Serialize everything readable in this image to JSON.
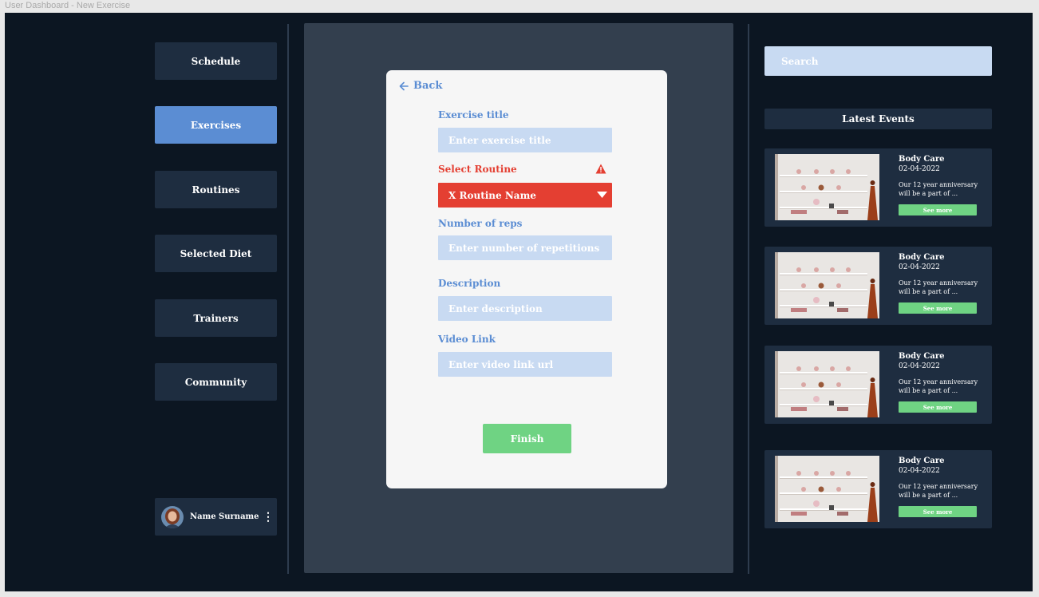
{
  "window": {
    "title": "User Dashboard - New Exercise"
  },
  "sidebar": {
    "items": [
      {
        "label": "Schedule",
        "active": false
      },
      {
        "label": "Exercises",
        "active": true
      },
      {
        "label": "Routines",
        "active": false
      },
      {
        "label": "Selected Diet",
        "active": false
      },
      {
        "label": "Trainers",
        "active": false
      },
      {
        "label": "Community",
        "active": false
      }
    ],
    "user": {
      "name": "Name Surname"
    }
  },
  "form": {
    "back_label": "Back",
    "exercise_title": {
      "label": "Exercise title",
      "placeholder": "Enter exercise title",
      "value": ""
    },
    "routine": {
      "label": "Select Routine",
      "value": "X Routine Name",
      "state": "error"
    },
    "reps": {
      "label": "Number of reps",
      "placeholder": "Enter number of repetitions",
      "value": ""
    },
    "description": {
      "label": "Description",
      "placeholder": "Enter description",
      "value": ""
    },
    "video_link": {
      "label": "Video Link",
      "placeholder": "Enter video link url",
      "value": ""
    },
    "finish_label": "Finish"
  },
  "right_panel": {
    "search_placeholder": "Search",
    "events_title": "Latest Events",
    "events": [
      {
        "title": "Body Care",
        "date": "02-04-2022",
        "description": "Our 12 year anniversary will be a part of ...",
        "cta": "See more"
      },
      {
        "title": "Body Care",
        "date": "02-04-2022",
        "description": "Our 12 year anniversary will be a part of ...",
        "cta": "See more"
      },
      {
        "title": "Body Care",
        "date": "02-04-2022",
        "description": "Our 12 year anniversary will be a part of ...",
        "cta": "See more"
      },
      {
        "title": "Body Care",
        "date": "02-04-2022",
        "description": "Our 12 year anniversary will be a part of ...",
        "cta": "See more"
      }
    ]
  },
  "colors": {
    "background": "#0c1622",
    "panel": "#1e2d40",
    "accent": "#5b8dd3",
    "error": "#e43f32",
    "success": "#6fd383",
    "input": "#c8daf2"
  }
}
